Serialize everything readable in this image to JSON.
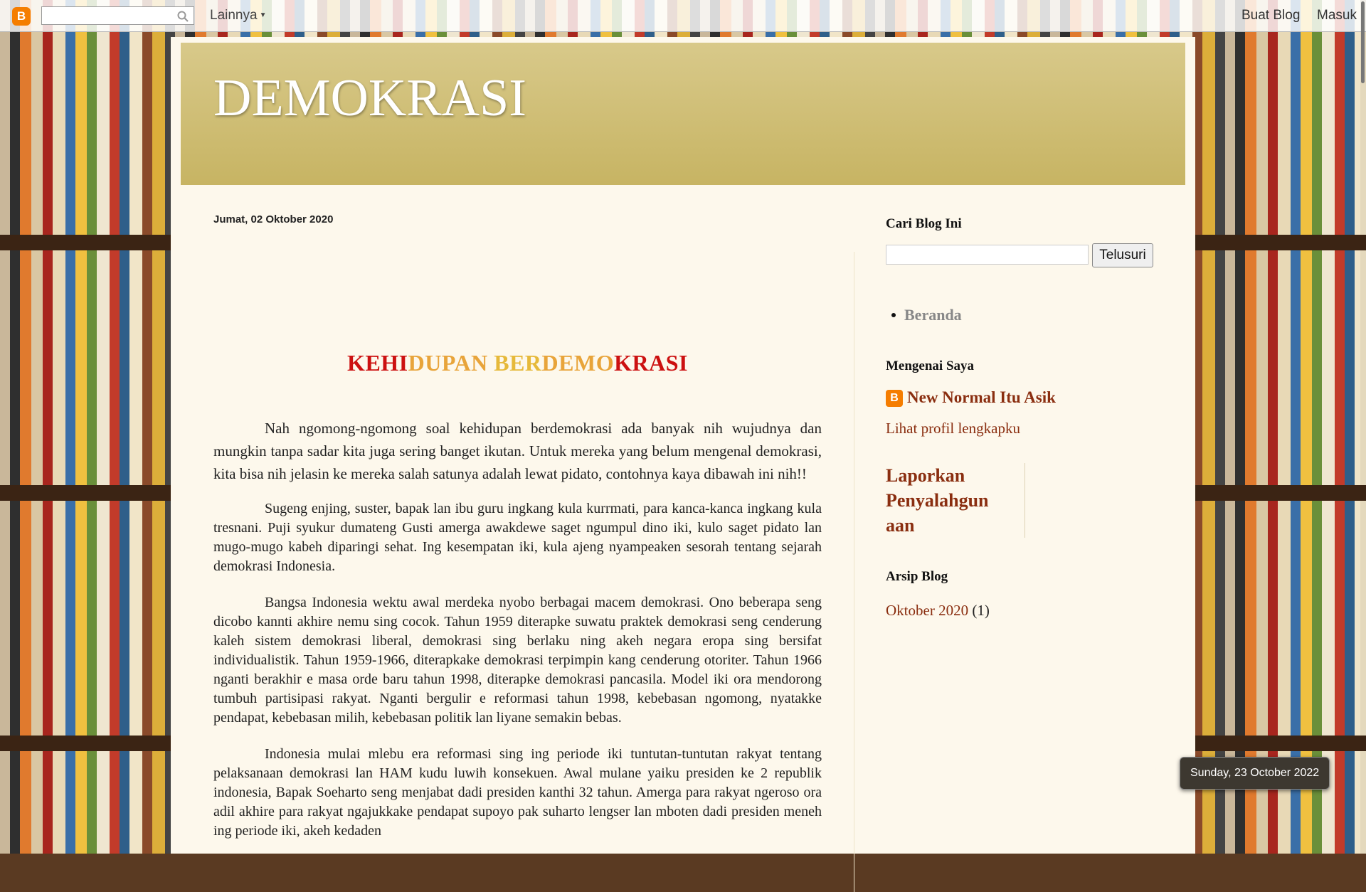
{
  "navbar": {
    "more_label": "Lainnya",
    "create_blog": "Buat Blog",
    "login": "Masuk",
    "logo_letter": "B",
    "search_placeholder": ""
  },
  "header": {
    "blog_title": "DEMOKRASI"
  },
  "post": {
    "date": "Jumat, 02 Oktober 2020",
    "title_parts": [
      "KEHI",
      "DUPAN ",
      "BER",
      "DEMO",
      "KRASI"
    ],
    "paragraphs": [
      "Nah ngomong-ngomong soal kehidupan berdemokrasi ada banyak nih wujudnya dan mungkin tanpa sadar kita juga sering banget ikutan. Untuk mereka yang belum mengenal demokrasi, kita bisa nih jelasin ke mereka salah satunya adalah lewat pidato, contohnya kaya dibawah ini nih!!",
      "Sugeng enjing, suster, bapak lan ibu guru ingkang kula kurrmati, para kanca-kanca ingkang kula tresnani. Puji syukur dumateng Gusti amerga awakdewe saget ngumpul dino iki, kulo saget pidato lan mugo-mugo kabeh diparingi sehat.  Ing kesempatan iki, kula ajeng nyampeaken sesorah tentang sejarah demokrasi Indonesia.",
      "Bangsa Indonesia wektu awal merdeka nyobo berbagai macem demokrasi. Ono beberapa seng dicobo kannti akhire nemu sing cocok. Tahun 1959 diterapke suwatu praktek demokrasi seng cenderung kaleh sistem demokrasi liberal, demokrasi sing berlaku ning akeh negara eropa sing bersifat individualistik. Tahun 1959-1966, diterapkake demokrasi terpimpin kang cenderung otoriter. Tahun 1966 nganti berakhir e masa orde baru tahun 1998, diterapke demokrasi pancasila. Model iki ora mendorong tumbuh partisipasi rakyat. Nganti bergulir e reformasi tahun 1998, kebebasan ngomong, nyatakke pendapat, kebebasan milih, kebebasan politik lan liyane semakin bebas.",
      "Indonesia mulai mlebu era reformasi sing ing periode iki tuntutan-tuntutan rakyat tentang pelaksanaan demokrasi lan HAM kudu luwih konsekuen. Awal mulane yaiku presiden ke 2 republik indonesia, Bapak Soeharto seng menjabat dadi presiden kanthi 32 tahun. Amerga para rakyat ngeroso ora adil akhire para rakyat ngajukkake pendapat supoyo pak suharto lengser lan mboten dadi presiden meneh ing  periode iki, akeh kedaden"
    ]
  },
  "sidebar": {
    "search_title": "Cari Blog Ini",
    "search_button": "Telusuri",
    "pages": [
      "Beranda"
    ],
    "about_title": "Mengenai Saya",
    "profile_name": "New Normal Itu Asik",
    "profile_link": "Lihat profil lengkapku",
    "report_link": "Laporkan Penyalahgun aan",
    "archive_title": "Arsip Blog",
    "archive_month": "Oktober 2020",
    "archive_count": "(1)"
  },
  "tooltip": {
    "date": "Sunday, 23 October 2022"
  },
  "colors": {
    "header_gold": "#c7b463",
    "link_brown": "#8a2e10",
    "title_red": "#cc1111",
    "title_orange": "#e8a43a",
    "content_bg": "#fdf8ec",
    "blogger_orange": "#f57d00"
  }
}
